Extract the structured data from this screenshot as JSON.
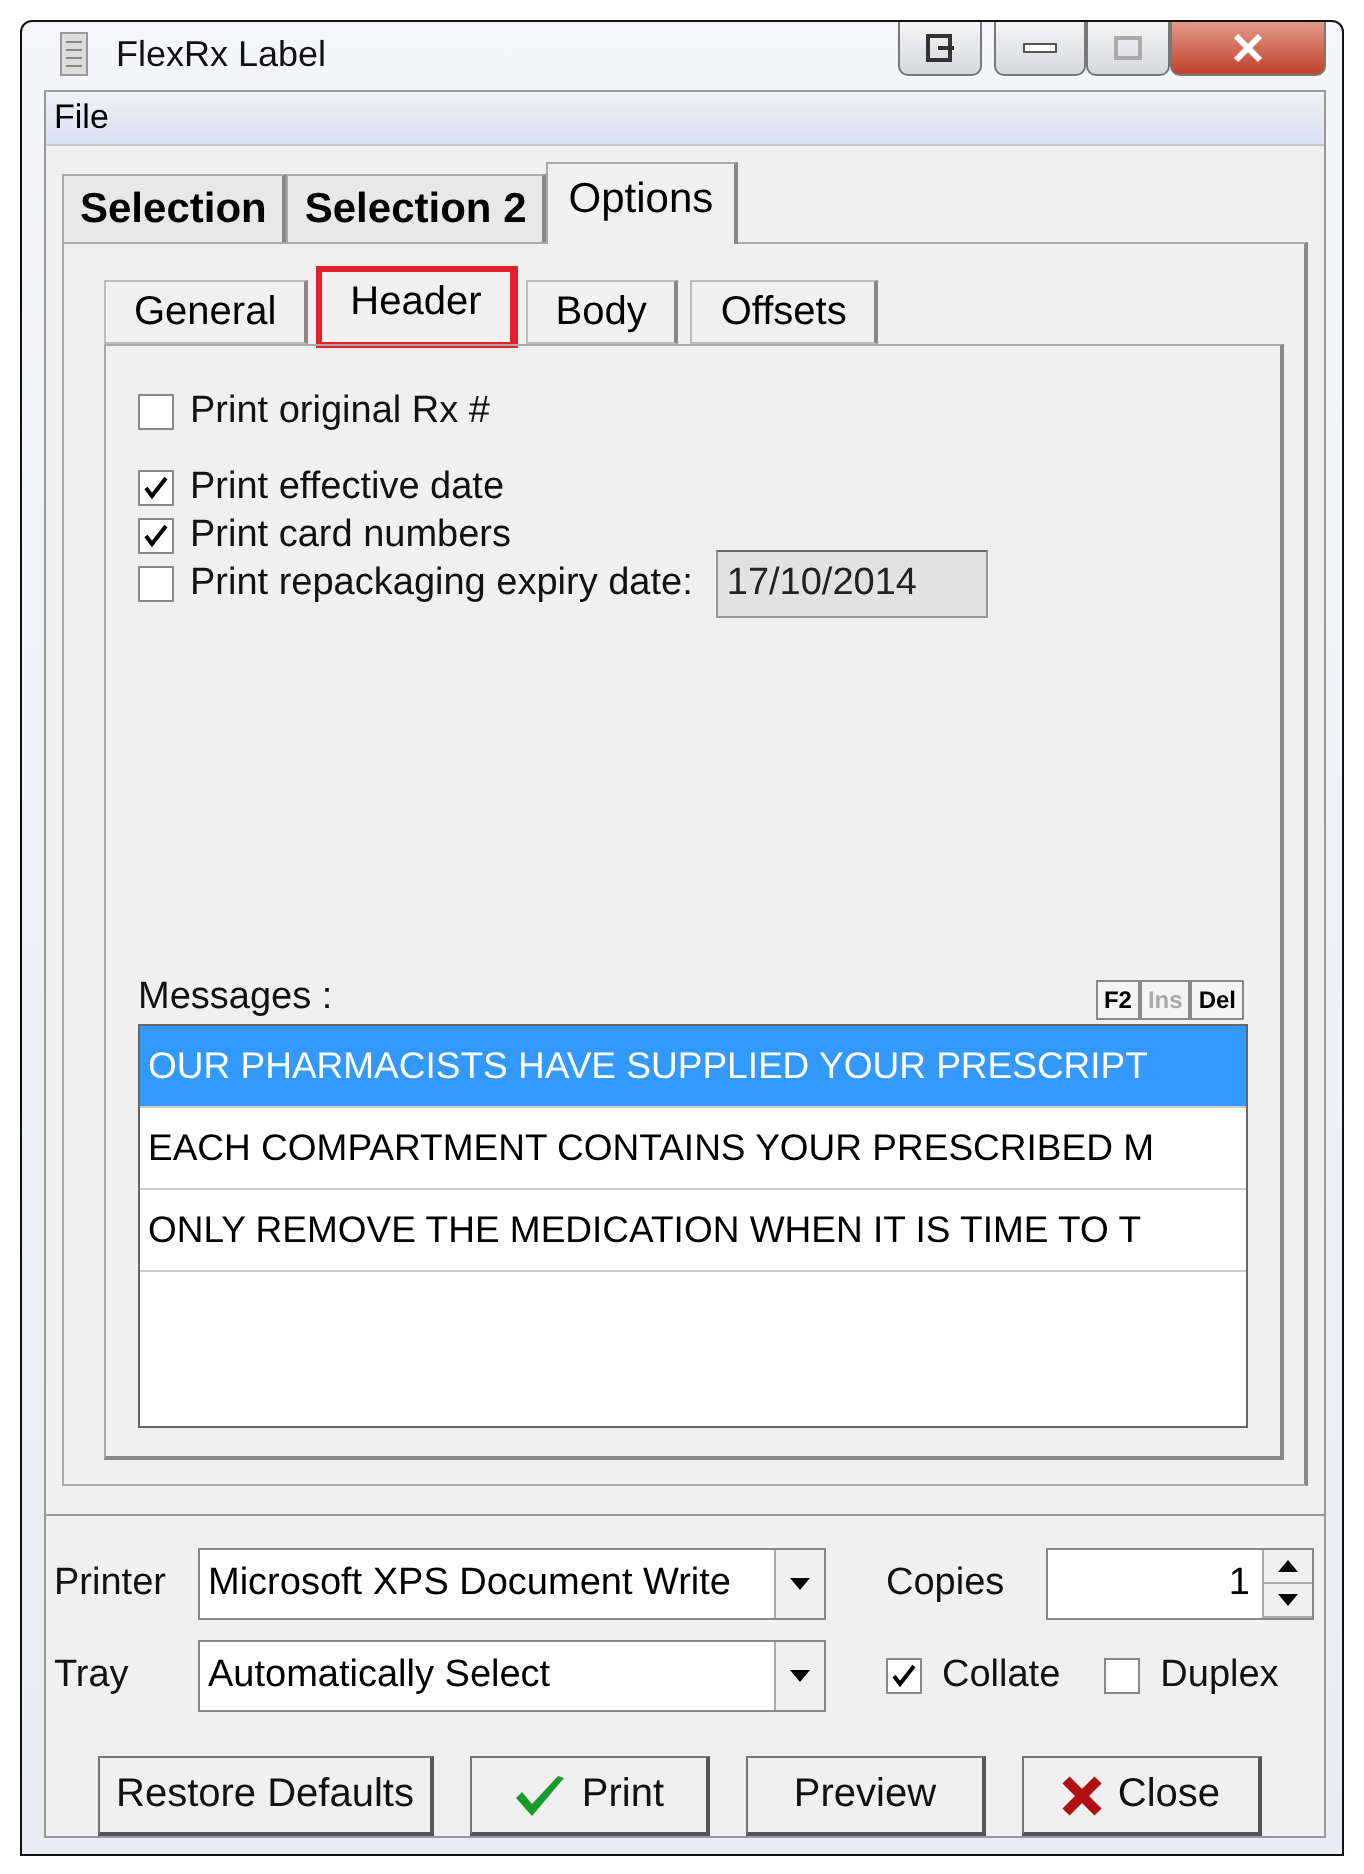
{
  "window": {
    "title": "FlexRx Label"
  },
  "menu": [
    "File"
  ],
  "tabs": [
    {
      "label": "Selection",
      "selected": false
    },
    {
      "label": "Selection 2",
      "selected": false
    },
    {
      "label": "Options",
      "selected": true
    }
  ],
  "subtabs": [
    {
      "label": "General",
      "selected": false,
      "highlighted": false
    },
    {
      "label": "Header",
      "selected": true,
      "highlighted": true
    },
    {
      "label": "Body",
      "selected": false,
      "highlighted": false
    },
    {
      "label": "Offsets",
      "selected": false,
      "highlighted": false
    }
  ],
  "options": [
    {
      "label": "Print original Rx #",
      "checked": false
    },
    {
      "label": "Print effective date",
      "checked": true
    },
    {
      "label": "Print card numbers",
      "checked": true
    },
    {
      "label": "Print repackaging expiry date:",
      "checked": false,
      "value": "17/10/2014"
    }
  ],
  "messages": {
    "label": "Messages :",
    "keys": [
      {
        "label": "F2",
        "disabled": false
      },
      {
        "label": "Ins",
        "disabled": true
      },
      {
        "label": "Del",
        "disabled": false
      }
    ],
    "rows": [
      {
        "text": "OUR PHARMACISTS HAVE SUPPLIED YOUR PRESCRIPT",
        "selected": true
      },
      {
        "text": "EACH COMPARTMENT CONTAINS YOUR PRESCRIBED M",
        "selected": false
      },
      {
        "text": "ONLY REMOVE THE MEDICATION WHEN IT IS TIME TO T",
        "selected": false
      }
    ]
  },
  "printer": {
    "label": "Printer",
    "value": "Microsoft XPS Document Write"
  },
  "tray": {
    "label": "Tray",
    "value": "Automatically Select"
  },
  "copies": {
    "label": "Copies",
    "value": "1"
  },
  "collate": {
    "label": "Collate",
    "checked": true
  },
  "duplex": {
    "label": "Duplex",
    "checked": false
  },
  "buttons": [
    {
      "label": "Restore Defaults",
      "kind": "plain"
    },
    {
      "label": "Print",
      "kind": "print"
    },
    {
      "label": "Preview",
      "kind": "plain"
    },
    {
      "label": "Close",
      "kind": "close"
    }
  ]
}
